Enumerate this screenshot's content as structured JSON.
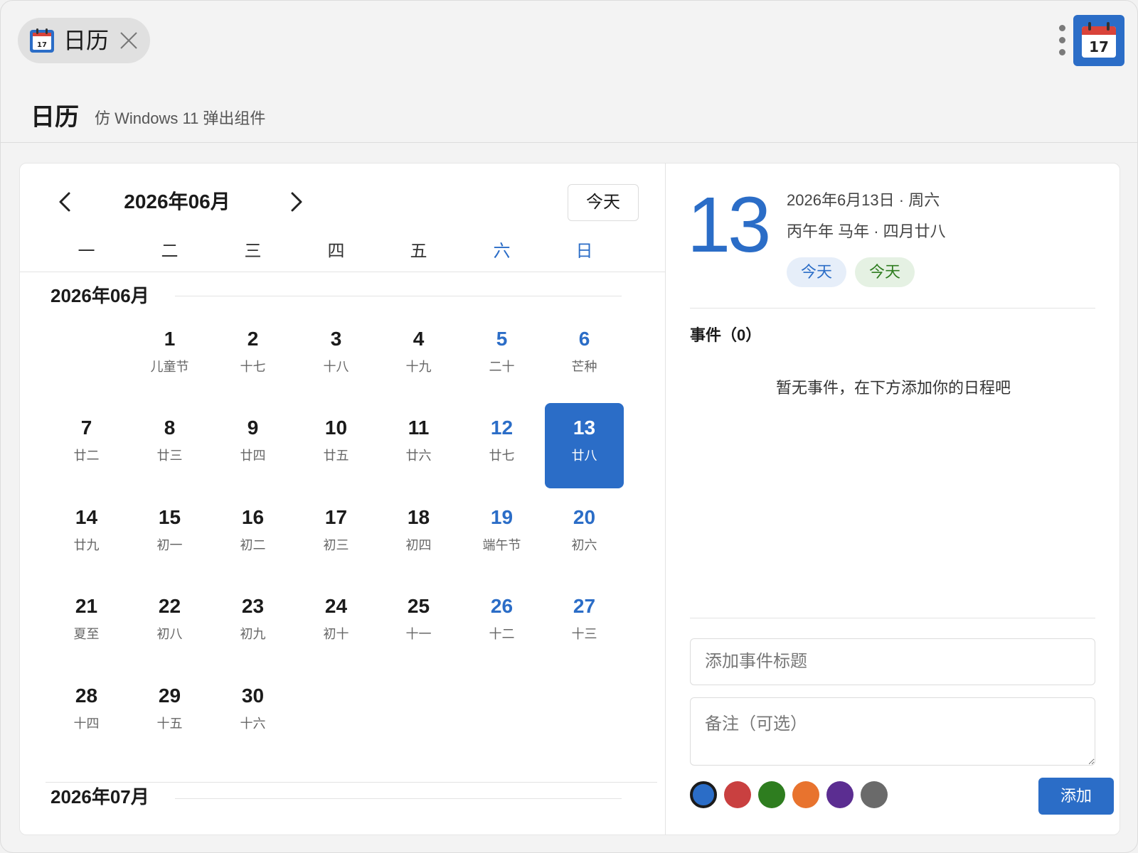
{
  "tab": {
    "label": "日历",
    "icon": "calendar-icon",
    "close_icon": "close-icon"
  },
  "toolbar": {
    "more_icon": "more-vertical-icon",
    "app_icon": "calendar-app-icon",
    "app_icon_day": "17"
  },
  "header": {
    "title": "日历",
    "subtitle": "仿 Windows 11 弹出组件"
  },
  "calendar": {
    "month_title": "2026年06月",
    "today_label": "今天",
    "prev_icon": "chevron-left-icon",
    "next_icon": "chevron-right-icon",
    "weekdays": [
      "一",
      "二",
      "三",
      "四",
      "五",
      "六",
      "日"
    ],
    "sections": [
      {
        "title": "2026年06月",
        "first_weekday_index": 1,
        "days": [
          {
            "d": "1",
            "l": "儿童节"
          },
          {
            "d": "2",
            "l": "十七"
          },
          {
            "d": "3",
            "l": "十八"
          },
          {
            "d": "4",
            "l": "十九"
          },
          {
            "d": "5",
            "l": "二十"
          },
          {
            "d": "6",
            "l": "芒种"
          },
          {
            "d": "7",
            "l": "廿二"
          },
          {
            "d": "8",
            "l": "廿三"
          },
          {
            "d": "9",
            "l": "廿四"
          },
          {
            "d": "10",
            "l": "廿五"
          },
          {
            "d": "11",
            "l": "廿六"
          },
          {
            "d": "12",
            "l": "廿七"
          },
          {
            "d": "13",
            "l": "廿八"
          },
          {
            "d": "14",
            "l": "廿九"
          },
          {
            "d": "15",
            "l": "初一"
          },
          {
            "d": "16",
            "l": "初二"
          },
          {
            "d": "17",
            "l": "初三"
          },
          {
            "d": "18",
            "l": "初四"
          },
          {
            "d": "19",
            "l": "端午节"
          },
          {
            "d": "20",
            "l": "初六"
          },
          {
            "d": "21",
            "l": "夏至"
          },
          {
            "d": "22",
            "l": "初八"
          },
          {
            "d": "23",
            "l": "初九"
          },
          {
            "d": "24",
            "l": "初十"
          },
          {
            "d": "25",
            "l": "十一"
          },
          {
            "d": "26",
            "l": "十二"
          },
          {
            "d": "27",
            "l": "十三"
          },
          {
            "d": "28",
            "l": "十四"
          },
          {
            "d": "29",
            "l": "十五"
          },
          {
            "d": "30",
            "l": "十六"
          }
        ],
        "selected_day": "13"
      },
      {
        "title": "2026年07月"
      }
    ]
  },
  "detail": {
    "day": "13",
    "date_line": "2026年6月13日 · 周六",
    "lunar_line": "丙午年 马年 · 四月廿八",
    "chips": [
      {
        "label": "今天",
        "color": "#2b6dc7"
      },
      {
        "label": "今天",
        "color": "#2e7d1f"
      }
    ],
    "events_title": "事件（0）",
    "empty_text": "暂无事件，在下方添加你的日程吧",
    "title_placeholder": "添加事件标题",
    "note_placeholder": "备注（可选）",
    "colors": [
      "#2b6dc7",
      "#c94040",
      "#2e7d1f",
      "#e8732e",
      "#5b2d91",
      "#6a6a6a"
    ],
    "selected_color_index": 0,
    "add_label": "添加"
  }
}
